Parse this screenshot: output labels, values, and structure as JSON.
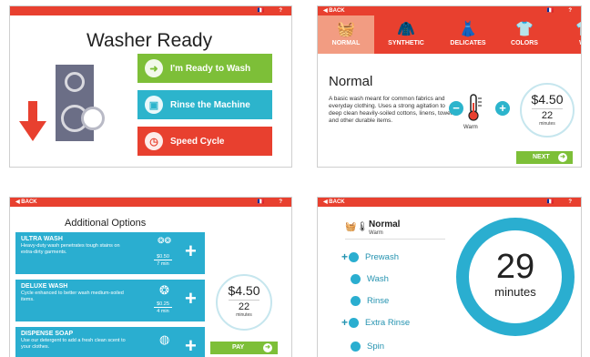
{
  "common": {
    "back": "BACK",
    "lang": "🇫🇷",
    "help": "?"
  },
  "panel1": {
    "title": "Washer Ready",
    "buttons": [
      {
        "label": "I'm Ready to Wash",
        "icon": "arrow-right-icon",
        "color": "#7dbf38"
      },
      {
        "label": "Rinse the Machine",
        "icon": "rinse-icon",
        "color": "#2cb4cc"
      },
      {
        "label": "Speed Cycle",
        "icon": "clock-icon",
        "color": "#e8402f"
      }
    ]
  },
  "panel2": {
    "tabs": [
      "NORMAL",
      "SYNTHETIC",
      "DELICATES",
      "COLORS",
      "WH"
    ],
    "cycle_title": "Normal",
    "description": "A basic wash meant for common fabrics and everyday clothing. Uses a strong agitation to deep clean heavily-soiled cottons, linens, towels and other durable items.",
    "temp_label": "Warm",
    "minus": "−",
    "plus": "+",
    "price": "$4.50",
    "minutes": "22",
    "minutes_unit": "minutes",
    "next": "NEXT"
  },
  "panel3": {
    "title": "Additional Options",
    "options": [
      {
        "name": "ULTRA WASH",
        "desc": "Heavy-duty wash penetrates tough stains on extra-dirty garments.",
        "price": "$0.50",
        "time": "7 min"
      },
      {
        "name": "DELUXE WASH",
        "desc": "Cycle enhanced to better wash medium-soiled items.",
        "price": "$0.25",
        "time": "4 min"
      },
      {
        "name": "DISPENSE SOAP",
        "desc": "Use our detergent to add a fresh clean scent to your clothes.",
        "price": "",
        "time": ""
      }
    ],
    "plus": "+",
    "price": "$4.50",
    "minutes": "22",
    "minutes_unit": "minutes",
    "pay": "PAY"
  },
  "panel4": {
    "cycle_name": "Normal",
    "cycle_temp": "Warm",
    "steps": [
      {
        "label": "Prewash",
        "added": true
      },
      {
        "label": "Wash",
        "added": false
      },
      {
        "label": "Rinse",
        "added": false
      },
      {
        "label": "Extra Rinse",
        "added": true
      },
      {
        "label": "Spin",
        "added": false
      }
    ],
    "plus": "+",
    "remaining": "29",
    "remaining_unit": "minutes"
  }
}
